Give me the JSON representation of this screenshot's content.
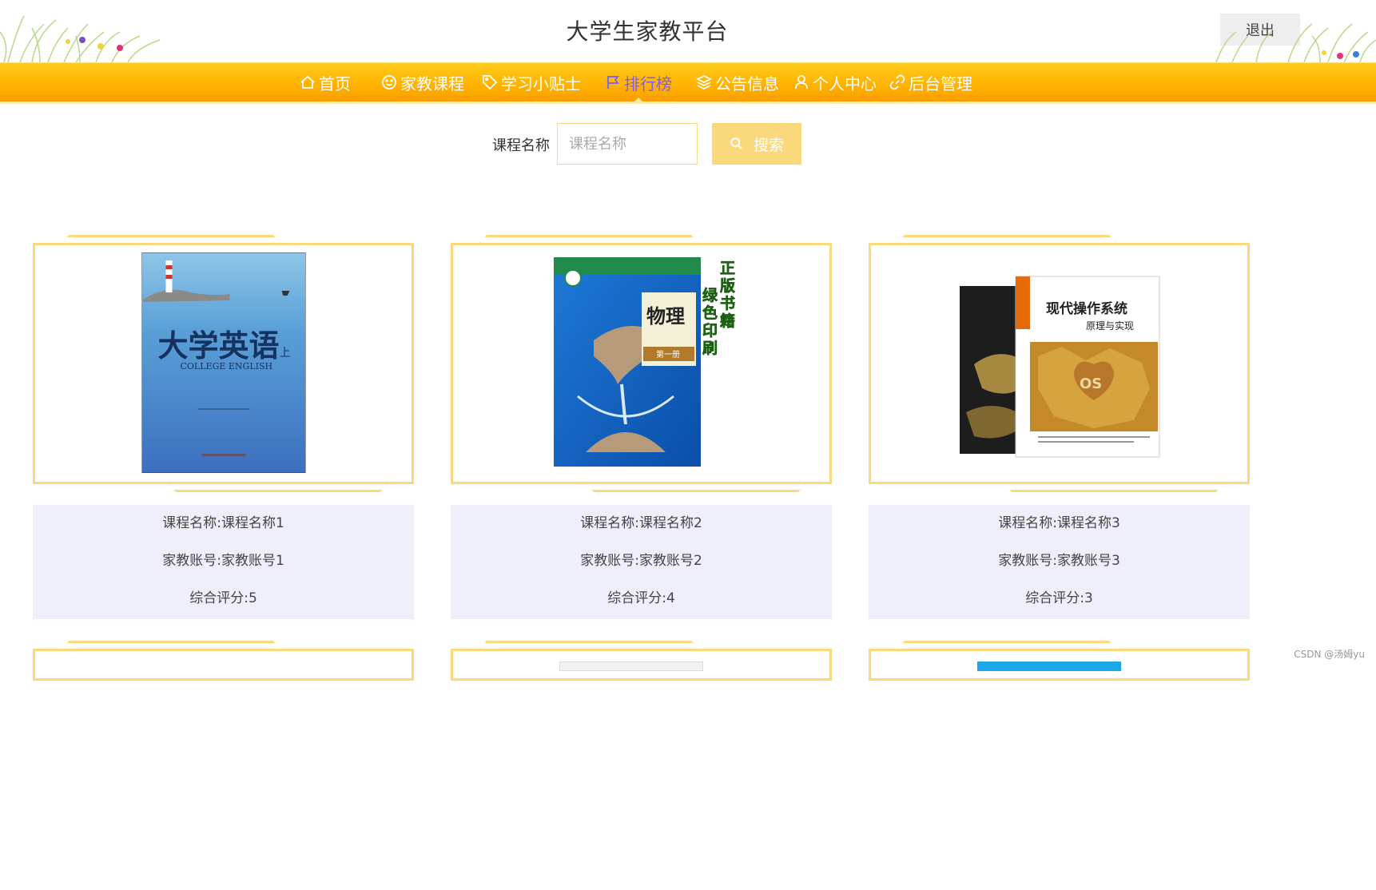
{
  "header": {
    "site_title": "大学生家教平台",
    "logout_label": "退出"
  },
  "nav": {
    "items": [
      {
        "label": "首页",
        "icon": "home-icon",
        "active": false
      },
      {
        "label": "家教课程",
        "icon": "smile-icon",
        "active": false
      },
      {
        "label": "学习小贴士",
        "icon": "tag-icon",
        "active": false
      },
      {
        "label": "排行榜",
        "icon": "flag-icon",
        "active": true
      },
      {
        "label": "公告信息",
        "icon": "layers-icon",
        "active": false
      },
      {
        "label": "个人中心",
        "icon": "user-icon",
        "active": false
      },
      {
        "label": "后台管理",
        "icon": "link-icon",
        "active": false
      }
    ],
    "active_color": "#7b5cff",
    "bar_color": "#ffb300"
  },
  "search": {
    "label": "课程名称",
    "placeholder": "课程名称",
    "button_label": "搜索",
    "button_icon": "search-icon"
  },
  "cards": [
    {
      "course": "课程名称:课程名称1",
      "teacher": "家教账号:家教账号1",
      "rating": "综合评分:5",
      "cover_text": "大学英语",
      "cover_sub": "COLLEGE ENGLISH",
      "cover_volume": "上"
    },
    {
      "course": "课程名称:课程名称2",
      "teacher": "家教账号:家教账号2",
      "rating": "综合评分:4",
      "cover_text": "物理",
      "cover_sub": "第一册",
      "side_text": "正版书籍绿色印刷"
    },
    {
      "course": "课程名称:课程名称3",
      "teacher": "家教账号:家教账号3",
      "rating": "综合评分:3",
      "cover_text": "现代操作系统",
      "cover_sub": "原理与实现",
      "cover_badge": "OS"
    }
  ],
  "watermark": "CSDN @汤姆yu"
}
